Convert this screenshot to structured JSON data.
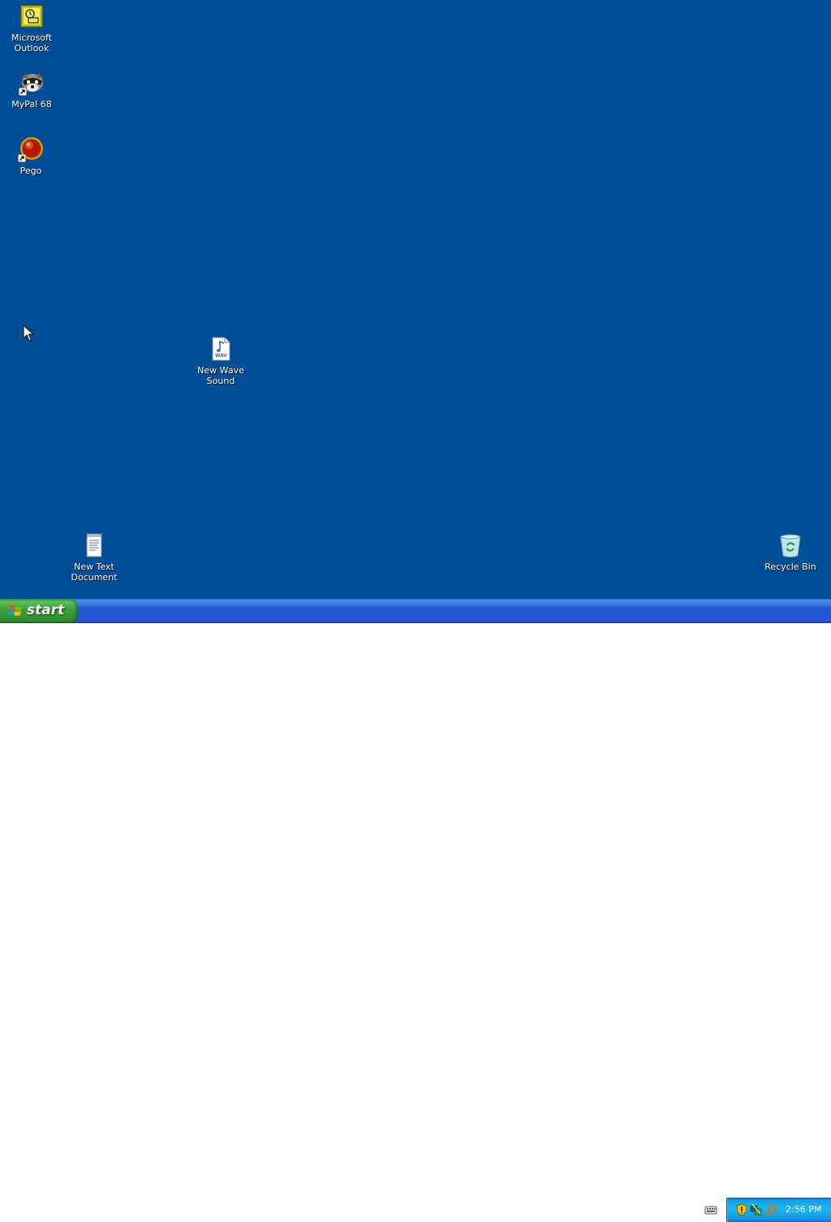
{
  "desktop": {
    "background_color": "#004e98",
    "icons": [
      {
        "label": "Microsoft\nOutlook",
        "icon": "outlook-icon"
      },
      {
        "label": "MyPal 68",
        "icon": "mypal-icon"
      },
      {
        "label": "Pego",
        "icon": "pego-icon"
      },
      {
        "label": "New Wave\nSound",
        "icon": "wav-file-icon"
      },
      {
        "label": "New Text\nDocument",
        "icon": "text-document-icon"
      },
      {
        "label": "Recycle Bin",
        "icon": "recycle-bin-icon"
      }
    ]
  },
  "taskbar": {
    "start_label": "start",
    "tray_icons": [
      "keyboard-icon",
      "security-shield-icon",
      "network-icon",
      "search-icon"
    ],
    "clock": "2:56 PM"
  },
  "colors": {
    "taskbar_blue": "#2157d7",
    "start_green": "#37a237",
    "tray_blue": "#18b9f2"
  }
}
